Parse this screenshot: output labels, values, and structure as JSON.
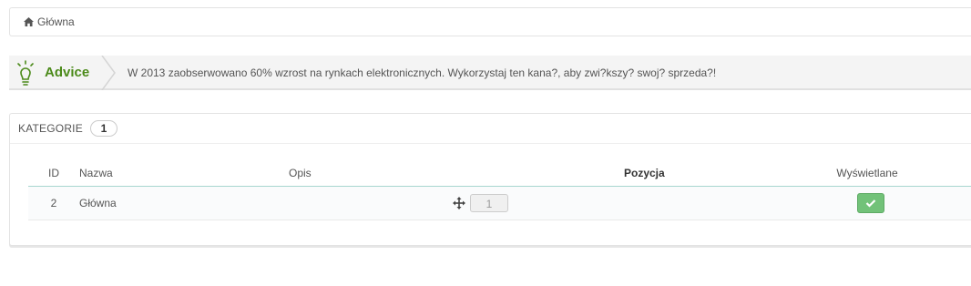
{
  "breadcrumb": {
    "icon": "home-icon",
    "label": "Główna"
  },
  "advice": {
    "icon": "lightbulb-icon",
    "title": "Advice",
    "text": "W 2013 zaobserwowano 60% wzrost na rynkach elektronicznych. Wykorzystaj ten kana?, aby zwi?kszy? swoj? sprzeda?!",
    "accent_color": "#4b8a1a"
  },
  "panel": {
    "title": "KATEGORIE",
    "count": "1",
    "columns": {
      "id": "ID",
      "name": "Nazwa",
      "description": "Opis",
      "position": "Pozycja",
      "displayed": "Wyświetlane"
    },
    "rows": [
      {
        "id": "2",
        "name": "Główna",
        "description": "",
        "position": "1",
        "displayed_icon": "check-icon",
        "displayed_color": "#72c279"
      }
    ]
  }
}
